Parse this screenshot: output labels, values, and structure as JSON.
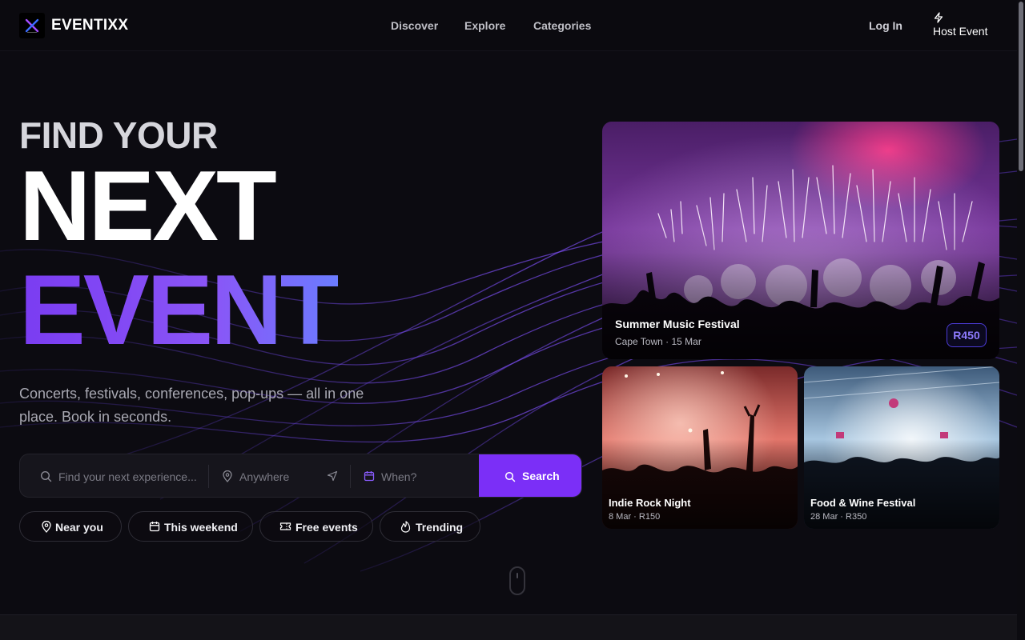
{
  "brand": {
    "name": "EVENTIXX",
    "accent": "#7b2ff7"
  },
  "nav": {
    "items": [
      {
        "label": "Discover"
      },
      {
        "label": "Explore"
      },
      {
        "label": "Categories"
      }
    ],
    "login": "Log In",
    "host": {
      "label": "Host Event",
      "icon": "bolt-icon"
    }
  },
  "hero": {
    "line1": "FIND YOUR",
    "line2": "NEXT",
    "line3": "EVENT",
    "subtitle": "Concerts, festivals, conferences, pop-ups — all in one place. Book in seconds."
  },
  "search": {
    "what_placeholder": "Find your next experience...",
    "where_placeholder": "Anywhere",
    "when_placeholder": "When?",
    "button_label": "Search"
  },
  "chips": [
    {
      "label": "Near you",
      "icon": "location-pin-icon"
    },
    {
      "label": "This weekend",
      "icon": "calendar-icon"
    },
    {
      "label": "Free events",
      "icon": "ticket-icon"
    },
    {
      "label": "Trending",
      "icon": "flame-icon"
    }
  ],
  "featured": {
    "title": "Summer Music Festival",
    "meta": "Cape Town · 15 Mar",
    "price": "R450"
  },
  "events": [
    {
      "title": "Indie Rock Night",
      "meta": "8 Mar · R150"
    },
    {
      "title": "Food & Wine Festival",
      "meta": "28 Mar · R350"
    }
  ]
}
